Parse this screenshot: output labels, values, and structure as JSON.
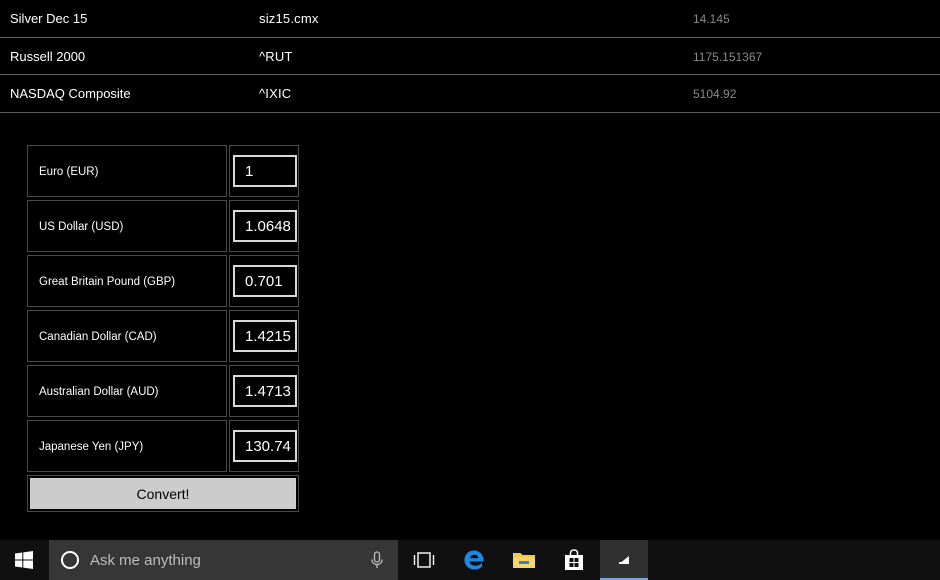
{
  "quotes": [
    {
      "name": "Silver Dec 15",
      "symbol": "siz15.cmx",
      "price": "14.145"
    },
    {
      "name": "Russell 2000",
      "symbol": "^RUT",
      "price": "1175.151367"
    },
    {
      "name": "NASDAQ Composite",
      "symbol": "^IXIC",
      "price": "5104.92"
    }
  ],
  "converter": {
    "rows": [
      {
        "label": "Euro (EUR)",
        "value": "1"
      },
      {
        "label": "US Dollar (USD)",
        "value": "1.0648"
      },
      {
        "label": "Great Britain Pound (GBP)",
        "value": "0.701"
      },
      {
        "label": "Canadian Dollar (CAD)",
        "value": "1.4215"
      },
      {
        "label": "Australian Dollar (AUD)",
        "value": "1.4713"
      },
      {
        "label": "Japanese Yen (JPY)",
        "value": "130.74"
      }
    ],
    "convert_label": "Convert!"
  },
  "taskbar": {
    "search_placeholder": "Ask me anything",
    "icons": [
      "windows-start-icon",
      "cortana-icon",
      "microphone-icon",
      "task-view-icon",
      "edge-icon",
      "file-explorer-icon",
      "store-icon",
      "stocks-app-icon"
    ]
  },
  "colors": {
    "background": "#000000",
    "price_text": "#8a8a8a",
    "taskbar": "#101010",
    "search_box": "#363636",
    "edge_blue": "#1e88e5",
    "folder_yellow": "#f2c94c",
    "active_underline": "#7ba4d8"
  }
}
